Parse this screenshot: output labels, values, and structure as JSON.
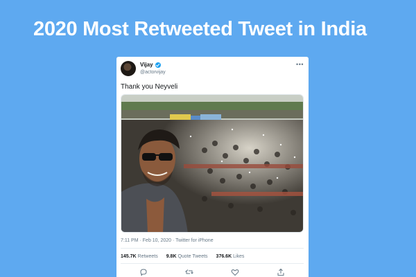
{
  "headline": "2020 Most Retweeted Tweet in India",
  "tweet": {
    "display_name": "Vijay",
    "handle": "@actorvijay",
    "text": "Thank you Neyveli",
    "timestamp": "7:11 PM · Feb 10, 2020 · Twitter for iPhone",
    "stats": {
      "retweets_count": "145.7K",
      "retweets_label": "Retweets",
      "quote_count": "9.8K",
      "quote_label": "Quote Tweets",
      "likes_count": "376.6K",
      "likes_label": "Likes"
    },
    "more_icon": "more-icon",
    "actions": [
      "reply-icon",
      "retweet-icon",
      "like-icon",
      "share-icon"
    ]
  },
  "colors": {
    "background": "#5ea9f0",
    "card": "#ffffff",
    "verified": "#1da1f2",
    "muted_text": "#657786"
  }
}
